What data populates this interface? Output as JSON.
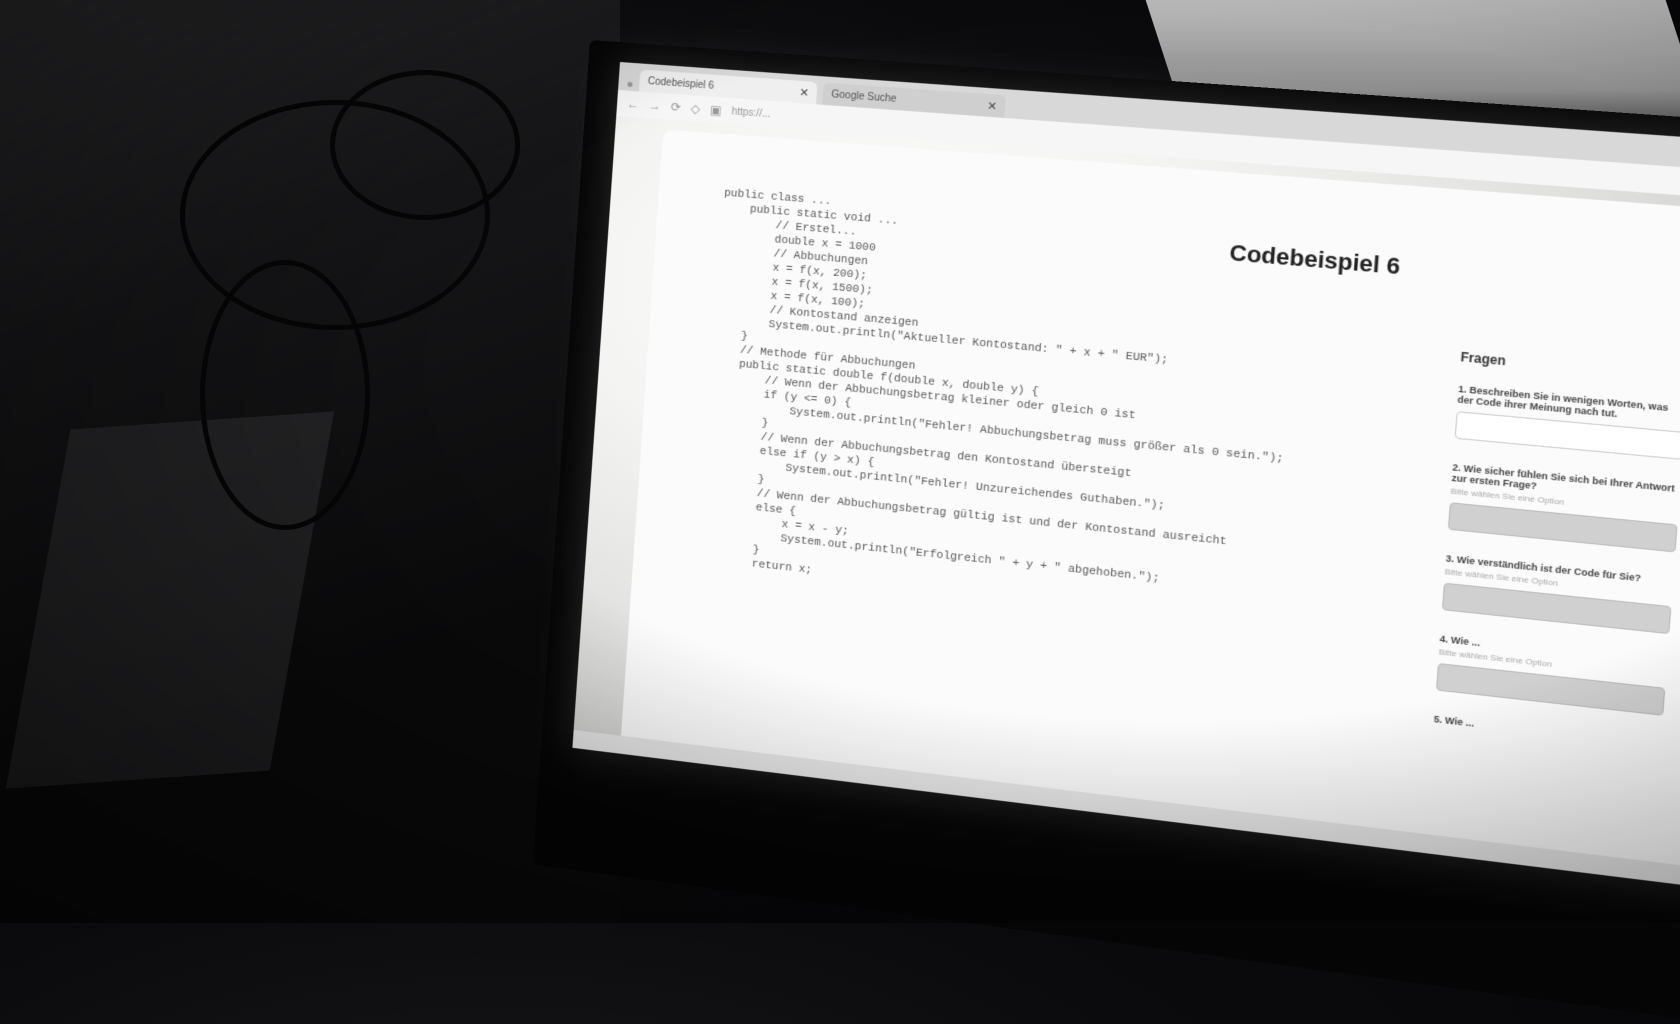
{
  "browser": {
    "tabs": [
      {
        "label": "Codebeispiel 6"
      },
      {
        "label": "Google Suche"
      }
    ],
    "url": "https://..."
  },
  "page": {
    "title": "Codebeispiel 6",
    "code_lines": [
      "public class ...",
      "    public static void ...",
      "        // Erstel...",
      "        double x = 1000",
      "        // Abbuchungen",
      "        x = f(x, 200);",
      "        x = f(x, 1500);",
      "        x = f(x, 100);",
      "        // Kontostand anzeigen",
      "        System.out.println(\"Aktueller Kontostand: \" + x + \" EUR\");",
      "    }",
      "    // Methode für Abbuchungen",
      "    public static double f(double x, double y) {",
      "        // Wenn der Abbuchungsbetrag kleiner oder gleich 0 ist",
      "        if (y <= 0) {",
      "            System.out.println(\"Fehler! Abbuchungsbetrag muss größer als 0 sein.\");",
      "        }",
      "        // Wenn der Abbuchungsbetrag den Kontostand übersteigt",
      "        else if (y > x) {",
      "            System.out.println(\"Fehler! Unzureichendes Guthaben.\");",
      "        }",
      "        // Wenn der Abbuchungsbetrag gültig ist und der Kontostand ausreicht",
      "        else {",
      "            x = x - y;",
      "            System.out.println(\"Erfolgreich \" + y + \" abgehoben.\");",
      "        }",
      "        return x;"
    ],
    "sidebar": {
      "heading": "Fragen",
      "questions": [
        {
          "text": "1. Beschreiben Sie in wenigen Worten, was der Code ihrer Meinung nach tut.",
          "hint": ""
        },
        {
          "text": "2. Wie sicher fühlen Sie sich bei Ihrer Antwort zur ersten Frage?",
          "hint": "Bitte wählen Sie eine Option"
        },
        {
          "text": "3. Wie verständlich ist der Code für Sie?",
          "hint": "Bitte wählen Sie eine Option"
        },
        {
          "text": "4. Wie ...",
          "hint": "Bitte wählen Sie eine Option"
        },
        {
          "text": "5. Wie ...",
          "hint": ""
        }
      ]
    }
  }
}
